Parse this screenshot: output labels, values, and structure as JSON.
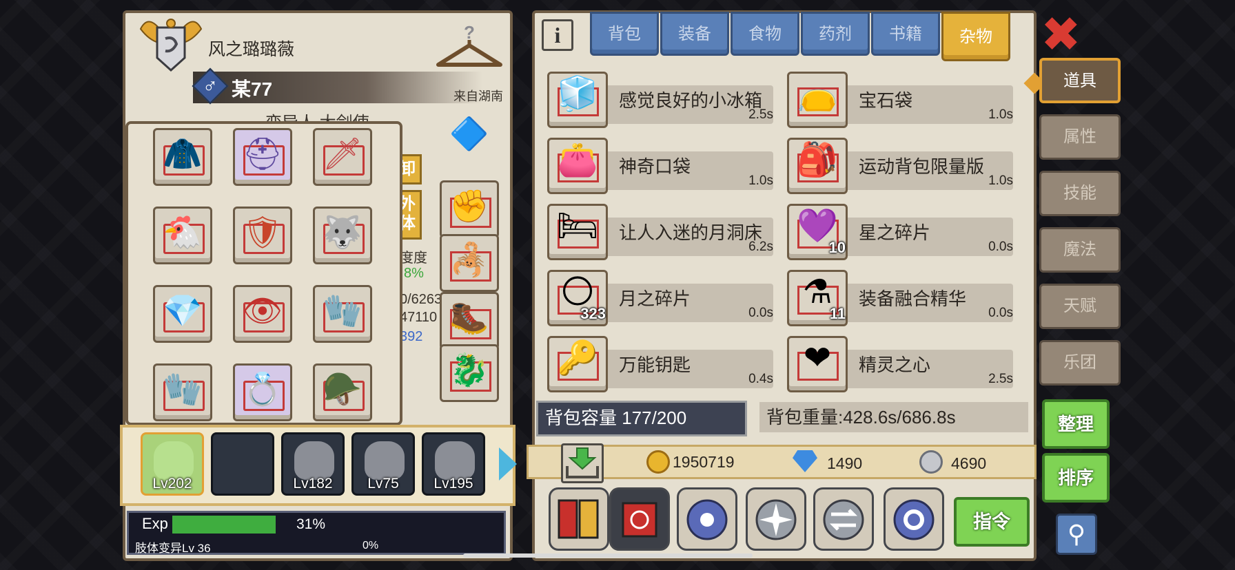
{
  "character": {
    "name": "风之璐璐薇",
    "alias": "某77",
    "gender_symbol": "♂",
    "origin": "来自湖南",
    "class_title": "变异人 大剑使",
    "partial_button_1": "卸",
    "partial_button_2_line1": "外",
    "partial_button_2_line2": "体",
    "partial_stat_label": "度度",
    "partial_stat_percent": "8%",
    "partial_stat_1": "0/6263",
    "partial_stat_2": "47110",
    "partial_stat_3": "392"
  },
  "equipment": [
    {
      "name": "blue-coat",
      "glyph": "🧥",
      "color": "#2f5fc4"
    },
    {
      "name": "purple-helmet",
      "glyph": "⛑",
      "color": "#5f4a9e"
    },
    {
      "name": "red-sword",
      "glyph": "🗡",
      "color": "#c4484a"
    },
    {
      "name": "chicken-weapon",
      "glyph": "🐔",
      "color": "#e89a3a"
    },
    {
      "name": "shield",
      "glyph": "🛡",
      "color": "#c8442a"
    },
    {
      "name": "beast-armor",
      "glyph": "🐺",
      "color": "#55606e"
    },
    {
      "name": "gem-amulet",
      "glyph": "💎",
      "color": "#3f6fd8"
    },
    {
      "name": "eye-ring",
      "glyph": "👁",
      "color": "#c2302c"
    },
    {
      "name": "white-glove",
      "glyph": "🧤",
      "color": "#c8ccd8"
    },
    {
      "name": "claw-glove",
      "glyph": "🧤",
      "color": "#3a3fa8"
    },
    {
      "name": "crown-ring",
      "glyph": "💍",
      "color": "#6a4bb8"
    },
    {
      "name": "knight-helm",
      "glyph": "🪖",
      "color": "#7c7c84"
    }
  ],
  "right_equipment": [
    {
      "name": "crest-badge",
      "glyph": "🔷",
      "color": "#4aa0a8"
    },
    {
      "name": "demon-glove",
      "glyph": "✊",
      "color": "#6a2430"
    },
    {
      "name": "spiked-armor",
      "glyph": "🦂",
      "color": "#6a3a2a"
    },
    {
      "name": "spiked-boots",
      "glyph": "🥾",
      "color": "#5a5a64"
    },
    {
      "name": "dragon-relic",
      "glyph": "🐉",
      "color": "#c4302c"
    }
  ],
  "party": [
    {
      "level": "Lv202",
      "selected": true
    },
    {
      "level": "",
      "selected": false
    },
    {
      "level": "Lv182",
      "selected": false
    },
    {
      "level": "Lv75",
      "selected": false
    },
    {
      "level": "Lv195",
      "selected": false
    }
  ],
  "exp": {
    "label": "Exp",
    "percent_text": "31%",
    "fill": 0.31
  },
  "limb": {
    "label": "肢体变异Lv 36",
    "percent_text": "0%"
  },
  "tabs": [
    "背包",
    "装备",
    "食物",
    "药剂",
    "书籍",
    "杂物"
  ],
  "active_tab": "杂物",
  "side_tabs": [
    "道具",
    "属性",
    "技能",
    "魔法",
    "天赋",
    "乐团"
  ],
  "items": [
    {
      "name": "感觉良好的小冰箱",
      "time": "2.5s",
      "glyph": "🧊",
      "count": ""
    },
    {
      "name": "宝石袋",
      "time": "1.0s",
      "glyph": "👝",
      "count": ""
    },
    {
      "name": "神奇口袋",
      "time": "1.0s",
      "glyph": "👛",
      "count": ""
    },
    {
      "name": "运动背包限量版",
      "time": "1.0s",
      "glyph": "🎒",
      "count": ""
    },
    {
      "name": "让人入迷的月洞床",
      "time": "6.2s",
      "glyph": "🛏",
      "count": ""
    },
    {
      "name": "星之碎片",
      "time": "0.0s",
      "glyph": "💜",
      "count": "10"
    },
    {
      "name": "月之碎片",
      "time": "0.0s",
      "glyph": "🌕",
      "count": "323"
    },
    {
      "name": "装备融合精华",
      "time": "0.0s",
      "glyph": "⚗",
      "count": "11"
    },
    {
      "name": "万能钥匙",
      "time": "0.4s",
      "glyph": "🔑",
      "count": ""
    },
    {
      "name": "精灵之心",
      "time": "2.5s",
      "glyph": "❤",
      "count": ""
    }
  ],
  "bag": {
    "capacity": "背包容量 177/200",
    "weight": "背包重量:428.6s/686.8s"
  },
  "currency": {
    "gold": "1950719",
    "diamond": "1490",
    "silver": "4690"
  },
  "buttons": {
    "sort_tidy": "整理",
    "sort_order": "排序",
    "command": "指令",
    "close": "✖",
    "info": "i"
  },
  "colors": {
    "accent_yellow": "#e5b23b",
    "tab_blue": "#5a80b8",
    "green_button": "#7fd354",
    "frame_brown": "#6e5c45"
  }
}
